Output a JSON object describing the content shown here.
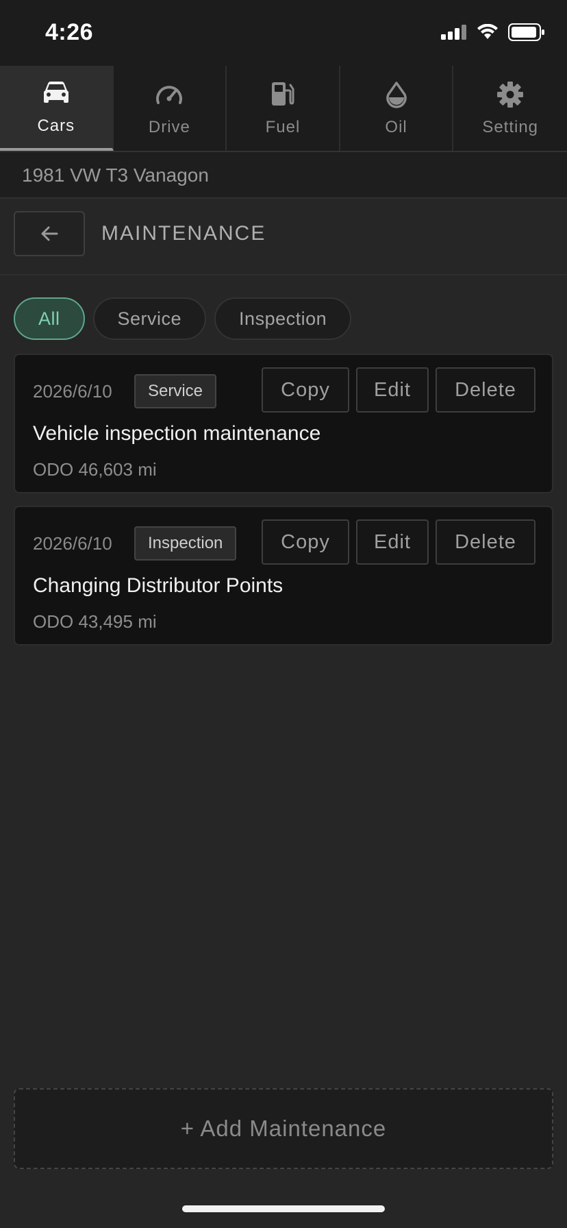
{
  "status_bar": {
    "time": "4:26"
  },
  "tabs": [
    {
      "label": "Cars",
      "icon": "car-icon",
      "active": true
    },
    {
      "label": "Drive",
      "icon": "gauge-icon",
      "active": false
    },
    {
      "label": "Fuel",
      "icon": "fuel-icon",
      "active": false
    },
    {
      "label": "Oil",
      "icon": "oil-drop-icon",
      "active": false
    },
    {
      "label": "Setting",
      "icon": "gear-icon",
      "active": false
    }
  ],
  "vehicle": {
    "name": "1981 VW T3 Vanagon"
  },
  "section": {
    "title": "MAINTENANCE"
  },
  "filters": [
    {
      "label": "All",
      "active": true
    },
    {
      "label": "Service",
      "active": false
    },
    {
      "label": "Inspection",
      "active": false
    }
  ],
  "records": [
    {
      "date": "2026/6/10",
      "tag": "Service",
      "title": "Vehicle inspection maintenance",
      "odo": "ODO 46,603 mi",
      "actions": {
        "copy": "Copy",
        "edit": "Edit",
        "delete": "Delete"
      }
    },
    {
      "date": "2026/6/10",
      "tag": "Inspection",
      "title": "Changing Distributor Points",
      "odo": "ODO 43,495 mi",
      "actions": {
        "copy": "Copy",
        "edit": "Edit",
        "delete": "Delete"
      }
    }
  ],
  "add_button": {
    "label": "+ Add Maintenance"
  },
  "colors": {
    "accent": "#7fd1b0",
    "background": "#262626",
    "card": "#121212"
  }
}
